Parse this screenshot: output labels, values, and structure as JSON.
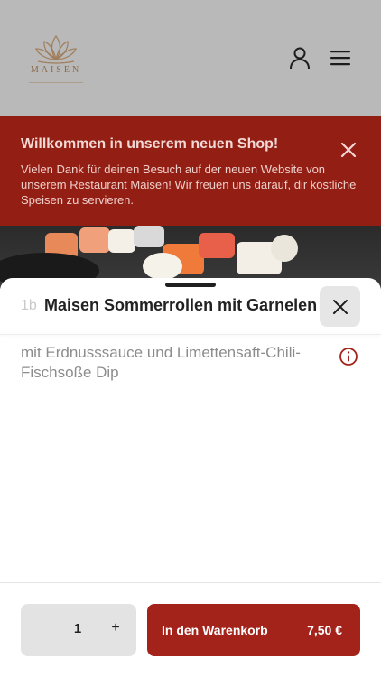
{
  "header": {
    "logo_text": "MAISEN",
    "colors": {
      "background": "#b9b9b9",
      "logo": "#a07e5c"
    },
    "icons": {
      "account": "user-icon",
      "menu": "hamburger-menu-icon"
    }
  },
  "banner": {
    "title": "Willkommen in unserem neuen Shop!",
    "text": "Vielen Dank für deinen Besuch auf der neuen Website von unserem Restaurant Maisen! Wir freuen uns darauf, dir köstliche Speisen zu servieren.",
    "close_icon": "close-icon",
    "color": "#921e14"
  },
  "product": {
    "number": "1b",
    "title": "Maisen Sommerrollen mit Garnelen",
    "description": "mit Erdnusssauce und Limettensaft-Chili-Fischsoße Dip",
    "info_icon": "info-icon",
    "close_icon": "close-icon"
  },
  "order": {
    "quantity": "1",
    "increment_label": "+",
    "add_to_cart_label": "In den Warenkorb",
    "price": "7,50 €",
    "accent": "#a3231a"
  }
}
